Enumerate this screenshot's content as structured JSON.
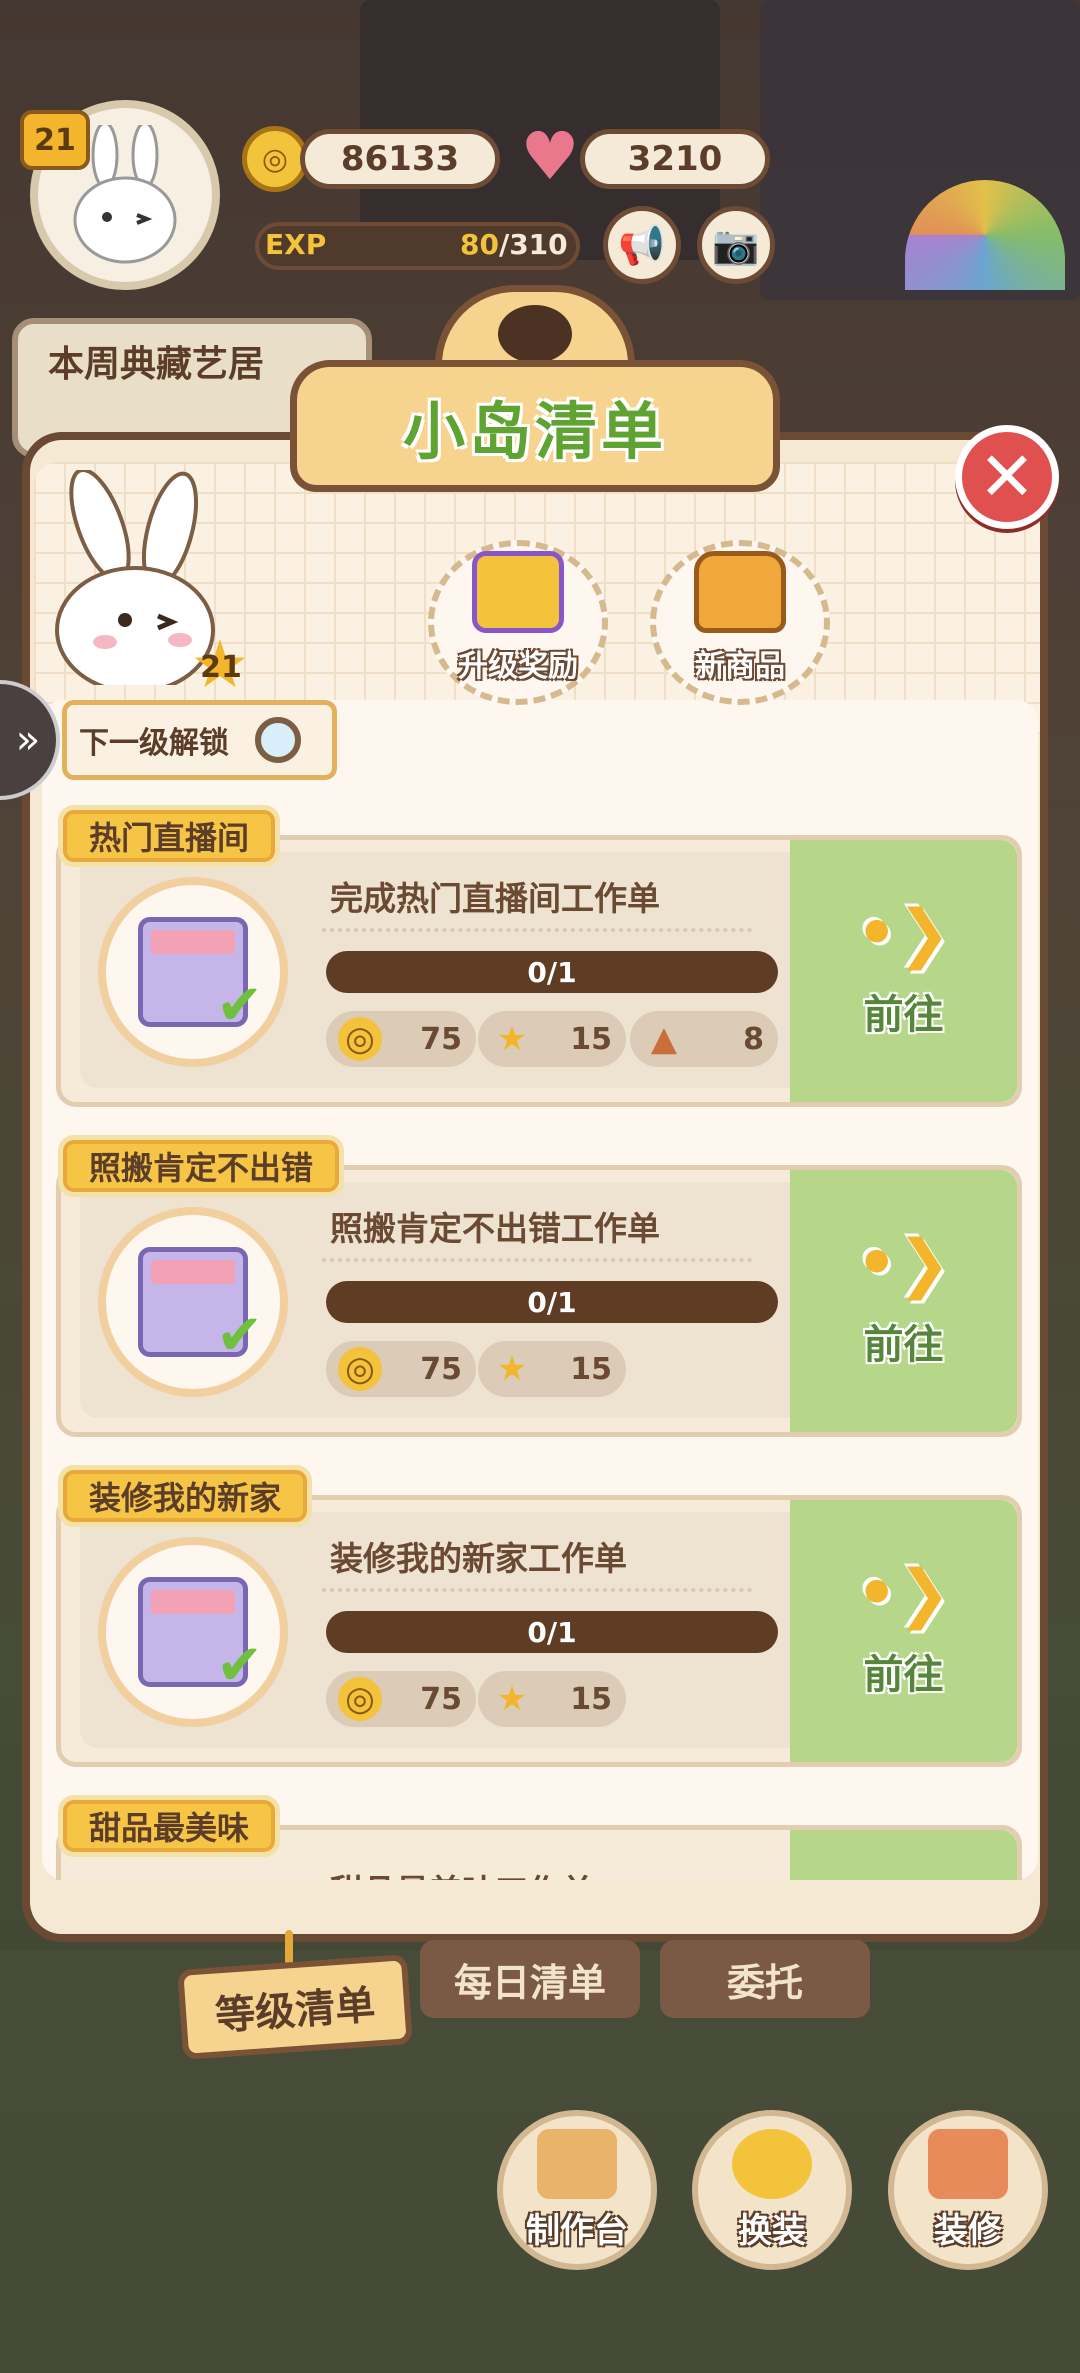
{
  "hud": {
    "player_level": "21",
    "coins": "86133",
    "hearts": "3210",
    "exp_label": "EXP",
    "exp_current": "80",
    "exp_total": "/310",
    "weekly_title": "本周典藏艺居"
  },
  "panel": {
    "title": "小岛清单",
    "bunny_level": "21",
    "next_unlock_label": "下一级解锁",
    "unlocks": [
      {
        "label": "升级奖励",
        "icon": "gift-icon"
      },
      {
        "label": "新商品",
        "icon": "bag-icon"
      }
    ]
  },
  "tasks": [
    {
      "tag": "热门直播间",
      "title": "完成热门直播间工作单",
      "progress": "0/1",
      "rewards": [
        {
          "icon": "coin-icon",
          "value": "75"
        },
        {
          "icon": "star-icon",
          "value": "15"
        },
        {
          "icon": "ore-icon",
          "value": "8"
        }
      ],
      "go_label": "前往"
    },
    {
      "tag": "照搬肯定不出错",
      "title": "照搬肯定不出错工作单",
      "progress": "0/1",
      "rewards": [
        {
          "icon": "coin-icon",
          "value": "75"
        },
        {
          "icon": "star-icon",
          "value": "15"
        }
      ],
      "go_label": "前往"
    },
    {
      "tag": "装修我的新家",
      "title": "装修我的新家工作单",
      "progress": "0/1",
      "rewards": [
        {
          "icon": "coin-icon",
          "value": "75"
        },
        {
          "icon": "star-icon",
          "value": "15"
        }
      ],
      "go_label": "前往"
    },
    {
      "tag": "甜品最美味",
      "title": "甜品最美味工作单"
    }
  ],
  "tabs": [
    "等级清单",
    "每日清单",
    "委托"
  ],
  "dock": [
    "制作台",
    "换装",
    "装修"
  ],
  "colors": {
    "accent_green": "#5fa333",
    "go_green": "#b6d78a",
    "tag_yellow": "#f6c545",
    "panel_brown": "#6b4a34"
  }
}
